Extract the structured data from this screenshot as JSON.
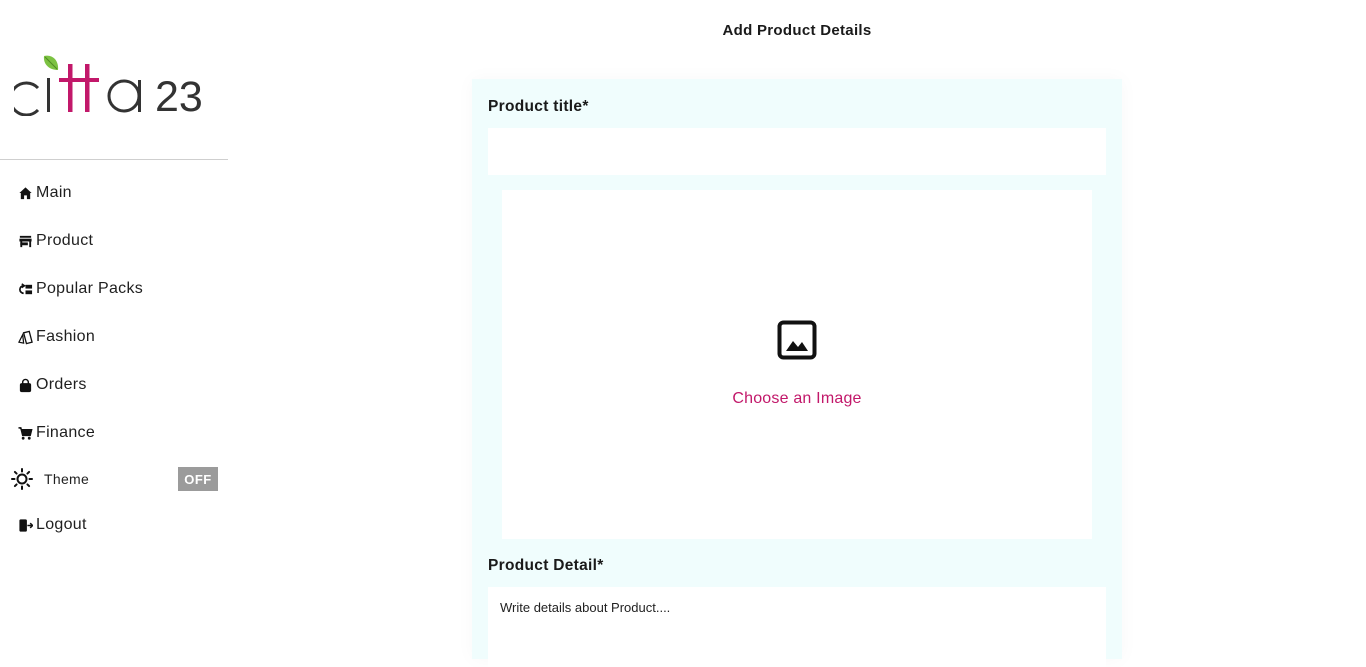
{
  "brand": {
    "logo_text": "citta 23",
    "accent_color": "#c2186a",
    "leaf_color": "#7cc242"
  },
  "sidebar": {
    "items": [
      {
        "label": "Main",
        "icon": "home-icon"
      },
      {
        "label": "Product",
        "icon": "store-icon"
      },
      {
        "label": "Popular Packs",
        "icon": "packs-icon"
      },
      {
        "label": "Fashion",
        "icon": "fashion-icon"
      },
      {
        "label": "Orders",
        "icon": "bag-icon"
      },
      {
        "label": "Finance",
        "icon": "cart-icon"
      }
    ],
    "theme": {
      "label": "Theme",
      "toggle": "OFF",
      "icon": "sun-icon"
    },
    "logout": {
      "label": "Logout",
      "icon": "logout-icon"
    }
  },
  "main": {
    "title": "Add Product Details",
    "product_title_label": "Product title*",
    "product_title_value": "",
    "image_upload": {
      "label": "Choose an Image",
      "icon": "image-icon"
    },
    "product_detail_label": "Product Detail*",
    "product_detail_placeholder": "Write details about Product...."
  }
}
